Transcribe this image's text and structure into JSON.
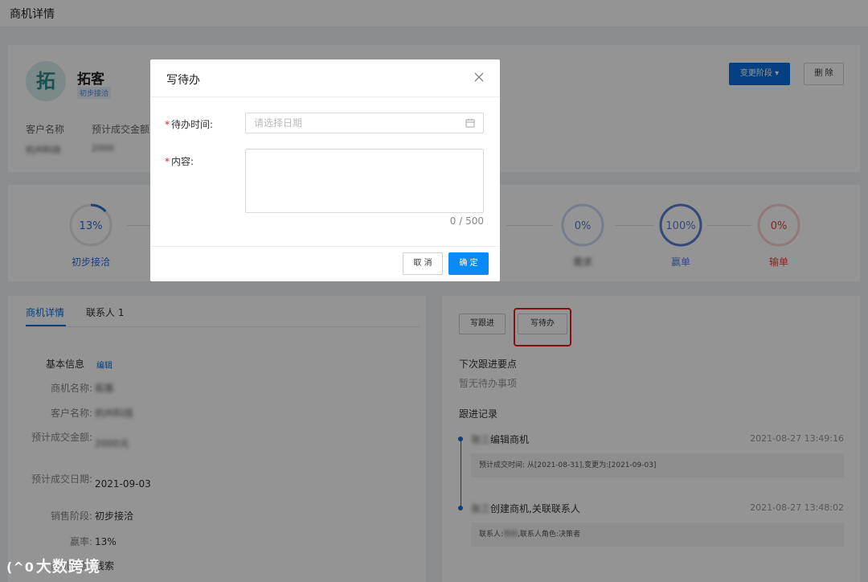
{
  "page_title": "商机详情",
  "header": {
    "avatar_char": "拓",
    "name": "拓客",
    "stage_tag": "初步接洽",
    "labels": [
      "客户名称",
      "预计成交金额"
    ],
    "values": [
      "杭州科技",
      "2000"
    ],
    "change_stage_label": "变更阶段",
    "delete_label": "删 除"
  },
  "stages": [
    {
      "percent": "13%",
      "name": "初步接洽",
      "progress": 0.13,
      "color": "#2f6fd6"
    },
    {
      "percent": "0%",
      "name": "需求",
      "progress": 0,
      "color": "#5a7fd0"
    },
    {
      "percent": "100%",
      "name": "赢单",
      "progress": 1,
      "color": "#5a7fd0"
    },
    {
      "percent": "0%",
      "name": "输单",
      "progress": 0,
      "color": "#e04040"
    }
  ],
  "left_panel": {
    "tabs": [
      "商机详情",
      "联系人 1"
    ],
    "section_title": "基本信息",
    "edit_label": "编辑",
    "fields": [
      {
        "label": "商机名称:",
        "value": "拓客"
      },
      {
        "label": "客户名称:",
        "value": "杭州科技"
      },
      {
        "label": "预计成交金额:",
        "value": "2000元"
      },
      {
        "label": "预计成交日期:",
        "value": "2021-09-03"
      },
      {
        "label": "销售阶段:",
        "value": "初步接洽"
      },
      {
        "label": "赢率:",
        "value": "13%"
      },
      {
        "label": "商机来源:",
        "value": "线索"
      }
    ]
  },
  "right_panel": {
    "write_followup_label": "写跟进",
    "write_todo_label": "写待办",
    "next_points_title": "下次跟进要点",
    "no_todo_text": "暂无待办事项",
    "records_title": "跟进记录",
    "records": [
      {
        "user": "张三",
        "action": "编辑商机",
        "time": "2021-08-27 13:49:16",
        "detail": "预计成交时间: 从[2021-08-31],变更为:[2021-09-03]"
      },
      {
        "user": "张三",
        "action": "创建商机,关联联系人",
        "time": "2021-08-27 13:48:02",
        "detail_prefix": "联系人:",
        "detail_blur": "李四",
        "detail_suffix": ",联系人角色:决策者"
      }
    ]
  },
  "modal": {
    "title": "写待办",
    "time_label": "待办时间:",
    "date_placeholder": "请选择日期",
    "content_label": "内容:",
    "counter": "0 / 500",
    "cancel_label": "取 消",
    "ok_label": "确 定"
  },
  "watermark": "大数跨境",
  "colors": {
    "primary": "#0a6ee0",
    "required": "#e02020",
    "highlight": "#e02020"
  }
}
